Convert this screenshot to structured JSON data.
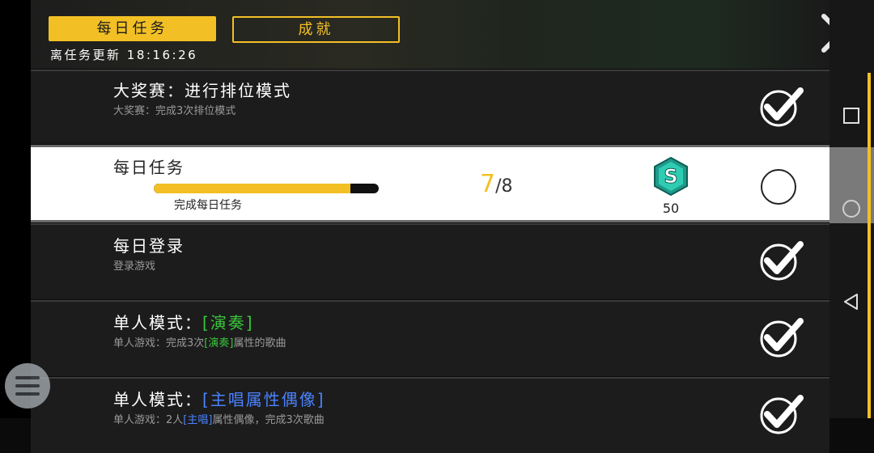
{
  "header": {
    "tab_daily": "每日任务",
    "tab_achievements": "成就",
    "refresh_label": "离任务更新",
    "refresh_time": "18:16:26"
  },
  "tasks": [
    {
      "title": "大奖赛：进行排位模式",
      "desc": "大奖赛：完成3次排位模式",
      "completed": true
    },
    {
      "title": "每日任务",
      "progress_label": "完成每日任务",
      "progress_current": "7",
      "progress_total": "/8",
      "progress_fraction": 0.875,
      "reward_icon": "s-gem-icon",
      "reward_amount": "50",
      "completed": false
    },
    {
      "title": "每日登录",
      "desc": "登录游戏",
      "completed": true
    },
    {
      "title_prefix": "单人模式：",
      "title_tag": "[演奏]",
      "desc_prefix": "单人游戏：完成3次",
      "desc_tag": "[演奏]",
      "desc_suffix": "属性的歌曲",
      "completed": true
    },
    {
      "title_prefix": "单人模式：",
      "title_tag": "[主唱属性偶像]",
      "desc_prefix": "单人游戏：2人",
      "desc_tag": "[主唱]",
      "desc_suffix": "属性偶像，完成3次歌曲",
      "completed": true
    }
  ],
  "colors": {
    "accent": "#f2c025",
    "tag_green": "#39c63a",
    "tag_blue": "#4a82ff"
  },
  "icons": {
    "close": "close-x-icon",
    "check": "checkmark-icon",
    "nav_recent": "square-icon",
    "nav_home": "circle-icon",
    "nav_back": "triangle-back-icon",
    "floating": "hamburger-menu-icon"
  }
}
